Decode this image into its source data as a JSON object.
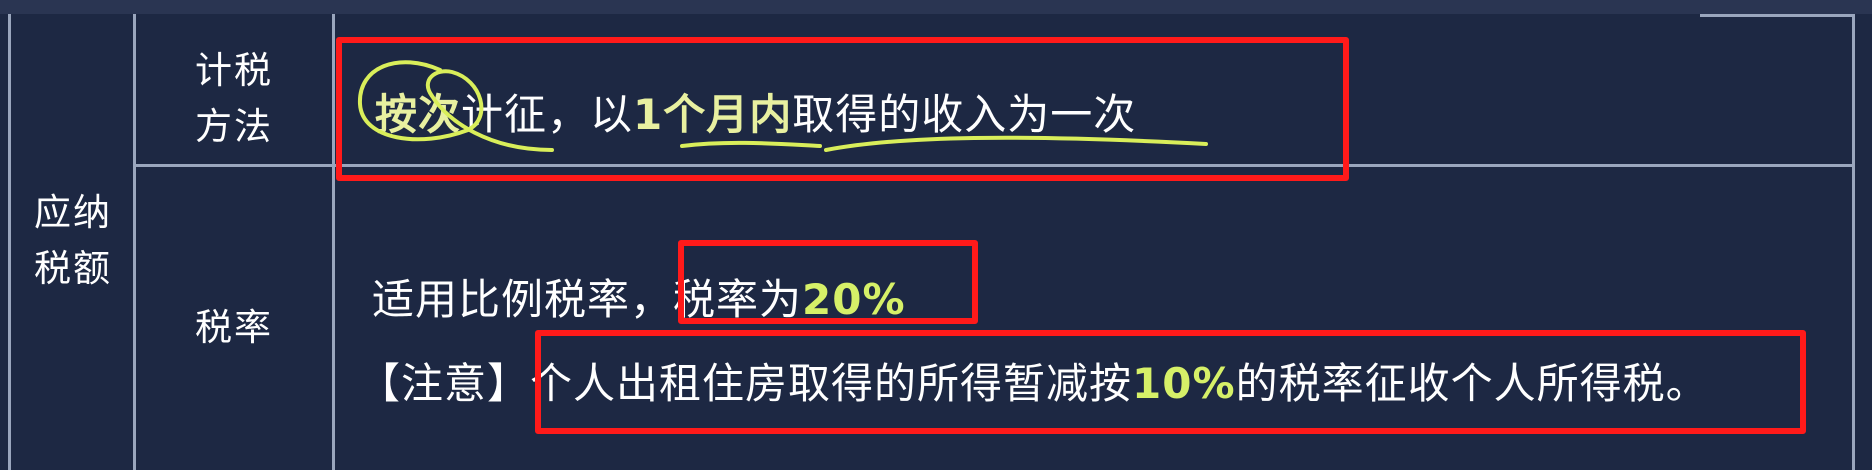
{
  "table": {
    "row_header": "应纳\n税额",
    "rows": [
      {
        "label": "计税\n方法",
        "content_parts": [
          "按次",
          "计征，以",
          "1个月内",
          "取得的收入为一次"
        ]
      },
      {
        "label": "税率",
        "line1_parts": [
          "适用比例税率，",
          "税率为",
          "20%"
        ],
        "line2_parts": [
          "【注意】",
          "个人出租住房取得的所得暂减按",
          "10%",
          "的税率征收个人所得税。"
        ]
      }
    ]
  },
  "colors": {
    "background": "#1d2843",
    "grid_line": "#9aa6bd",
    "highlight_text": "#d6f068",
    "annotation_box": "#ff1a1a",
    "annotation_ink": "#d9ee5a"
  }
}
